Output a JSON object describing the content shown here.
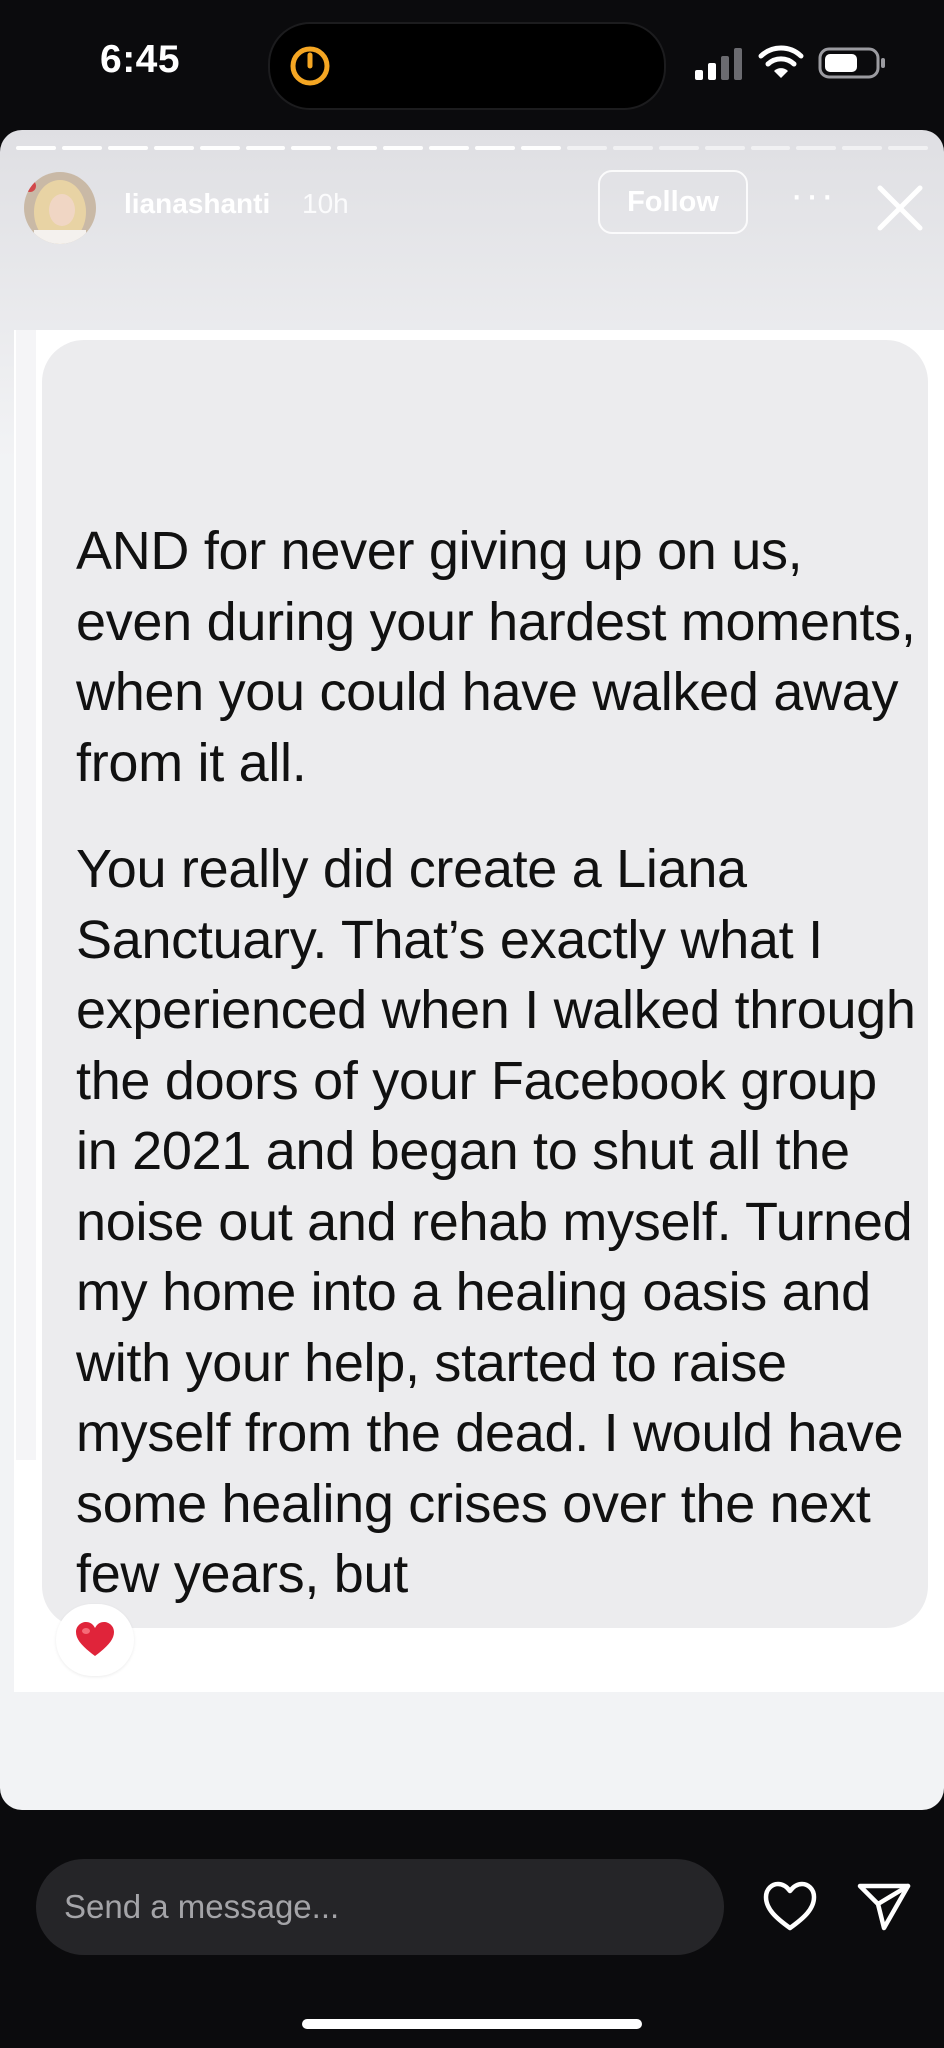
{
  "status_bar": {
    "time": "6:45"
  },
  "story": {
    "username": "lianashanti",
    "time_ago": "10h",
    "follow_label": "Follow",
    "more_label": "···",
    "progress": {
      "segments": 20,
      "completed": 12
    }
  },
  "message": {
    "paragraph_1": "AND for never giving up on us, even during your hardest moments, when you could have walked away from it all.",
    "paragraph_2": "You really did create a Liana Sanctuary. That’s exactly what I experienced when I walked through the doors of your Facebook group in 2021 and began to shut all the noise out and rehab myself. Turned my home into a healing oasis and with your help, started to raise myself from the dead. I would have some healing crises over the next few years, but",
    "reaction": "heart"
  },
  "reply_bar": {
    "placeholder": "Send a message..."
  },
  "colors": {
    "heart": "#e0243a",
    "background": "#0b0b0d",
    "bubble": "#ececee",
    "timer": "#f5a623"
  }
}
